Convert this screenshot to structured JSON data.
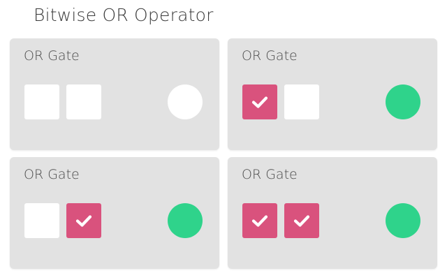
{
  "page": {
    "title": "Bitwise OR Operator"
  },
  "colors": {
    "card_background": "#e2e2e2",
    "checkbox_off": "#ffffff",
    "checkbox_on": "#d9527d",
    "output_off": "#ffffff",
    "output_on": "#2fd38b"
  },
  "gates": [
    {
      "title": "OR Gate",
      "input_a": false,
      "input_b": false,
      "output": false
    },
    {
      "title": "OR Gate",
      "input_a": true,
      "input_b": false,
      "output": true
    },
    {
      "title": "OR Gate",
      "input_a": false,
      "input_b": true,
      "output": true
    },
    {
      "title": "OR Gate",
      "input_a": true,
      "input_b": true,
      "output": true
    }
  ]
}
